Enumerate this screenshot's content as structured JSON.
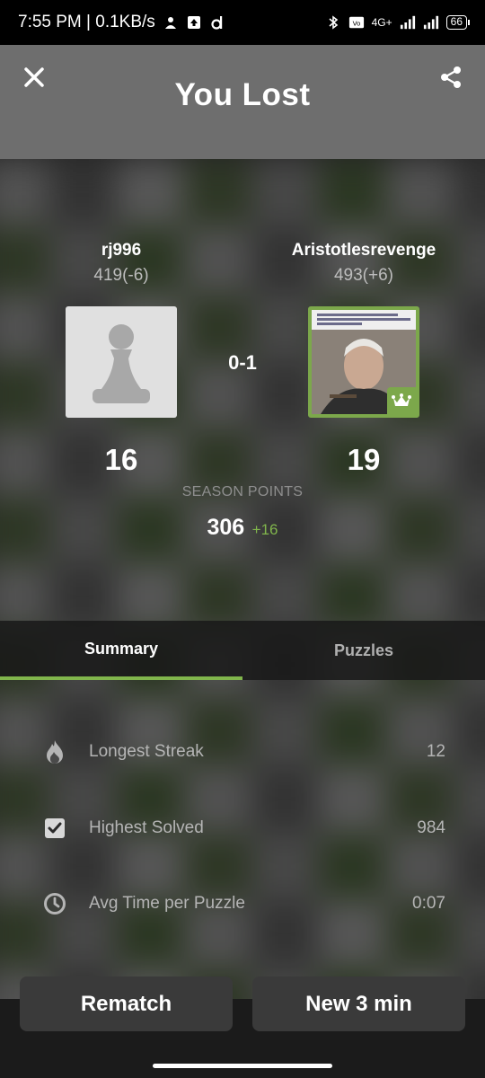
{
  "status_bar": {
    "time_speed": "7:55 PM | 0.1KB/s",
    "network_label": "4G+",
    "battery": "66"
  },
  "header": {
    "title": "You Lost"
  },
  "players": {
    "left": {
      "name": "rj996",
      "rating": "419(-6)",
      "season_points": "16"
    },
    "right": {
      "name": "Aristotlesrevenge",
      "rating": "493(+6)",
      "season_points": "19"
    },
    "score": "0-1"
  },
  "season": {
    "label": "SEASON POINTS",
    "total": "306",
    "delta": "+16"
  },
  "tabs": [
    {
      "label": "Summary",
      "active": true
    },
    {
      "label": "Puzzles",
      "active": false
    }
  ],
  "summary": [
    {
      "icon": "flame-icon",
      "label": "Longest Streak",
      "value": "12"
    },
    {
      "icon": "checkbox-icon",
      "label": "Highest Solved",
      "value": "984"
    },
    {
      "icon": "clock-icon",
      "label": "Avg Time per Puzzle",
      "value": "0:07"
    }
  ],
  "buttons": {
    "rematch": "Rematch",
    "new_game": "New 3 min"
  },
  "colors": {
    "accent_green": "#81b64c",
    "header_bg": "#6e6e6e",
    "button_bg": "#3a3a3a"
  }
}
